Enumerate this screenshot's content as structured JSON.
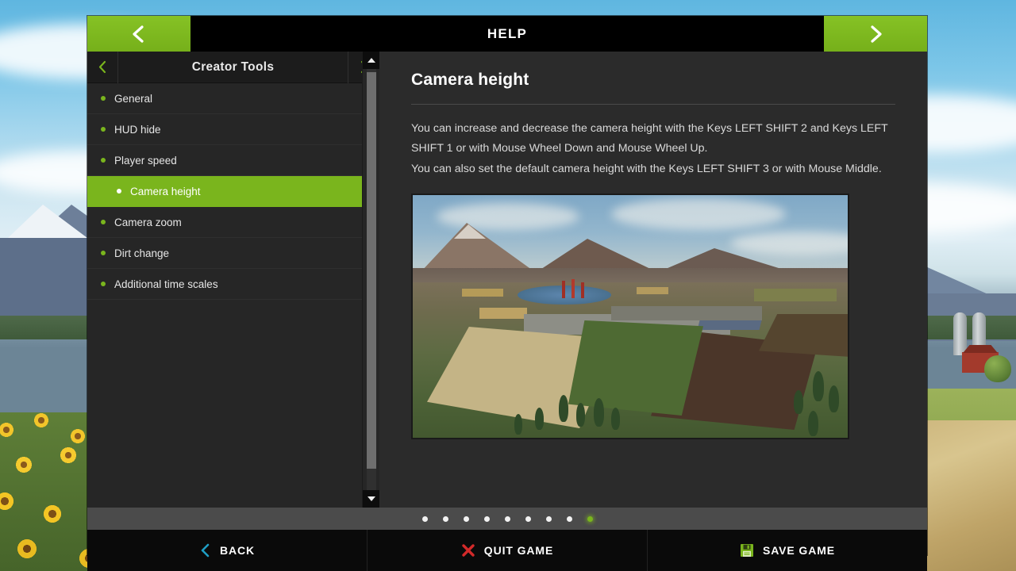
{
  "window": {
    "header_title": "HELP",
    "prev_icon": "chevron-left-icon",
    "next_icon": "chevron-right-icon"
  },
  "sidebar": {
    "header": {
      "title": "Creator Tools",
      "prev_icon": "chevron-left-icon",
      "next_icon": "chevron-right-icon"
    },
    "items": [
      {
        "label": "General",
        "level": 0,
        "active": false
      },
      {
        "label": "HUD hide",
        "level": 0,
        "active": false
      },
      {
        "label": "Player speed",
        "level": 0,
        "active": false
      },
      {
        "label": "Camera height",
        "level": 1,
        "active": true
      },
      {
        "label": "Camera zoom",
        "level": 0,
        "active": false
      },
      {
        "label": "Dirt change",
        "level": 0,
        "active": false
      },
      {
        "label": "Additional time scales",
        "level": 0,
        "active": false
      }
    ],
    "scrollbar": {
      "up_icon": "triangle-up-icon",
      "down_icon": "triangle-down-icon"
    }
  },
  "content": {
    "title": "Camera height",
    "paragraphs": [
      "You can increase and decrease the camera height with the Keys LEFT SHIFT 2 and Keys LEFT SHIFT 1 or with Mouse Wheel Down and Mouse Wheel Up.",
      "You can also set the default camera height with the Keys LEFT SHIFT 3 or with Mouse Middle."
    ],
    "image_alt": "farm-valley-aerial-screenshot"
  },
  "pagination": {
    "total": 9,
    "active_index": 8
  },
  "footer": {
    "buttons": [
      {
        "label": "BACK",
        "icon": "chevron-left-icon",
        "color": "#1f9ec4"
      },
      {
        "label": "QUIT GAME",
        "icon": "cross-icon",
        "color": "#d32a2a"
      },
      {
        "label": "SAVE GAME",
        "icon": "floppy-disk-icon",
        "color": "#7ab51d"
      }
    ]
  },
  "colors": {
    "accent_green": "#7ab51d",
    "panel_dark": "#2b2b2b",
    "sidebar_dark": "#262626",
    "header_black": "#000000"
  }
}
